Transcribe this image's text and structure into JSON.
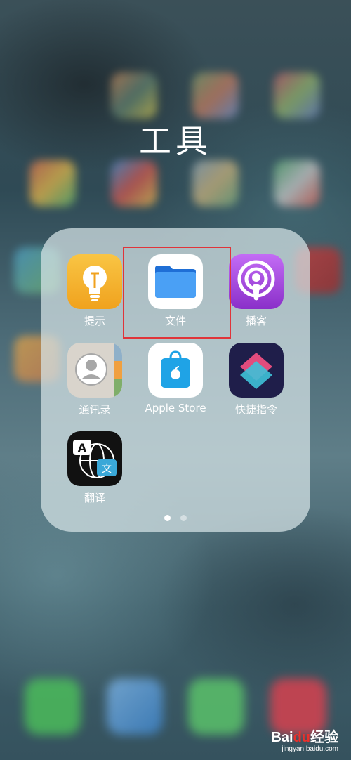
{
  "folder": {
    "title": "工具",
    "apps": [
      {
        "label": "提示",
        "icon": "tips-lightbulb-icon"
      },
      {
        "label": "文件",
        "icon": "files-folder-icon",
        "highlighted": true
      },
      {
        "label": "播客",
        "icon": "podcasts-icon"
      },
      {
        "label": "通讯录",
        "icon": "contacts-icon"
      },
      {
        "label": "Apple Store",
        "icon": "apple-store-bag-icon"
      },
      {
        "label": "快捷指令",
        "icon": "shortcuts-icon"
      },
      {
        "label": "翻译",
        "icon": "translate-icon"
      }
    ],
    "page_count": 2,
    "current_page": 1
  },
  "watermark": {
    "brand_left": "Bai",
    "brand_paw": "du",
    "brand_right": "经验",
    "url": "jingyan.baidu.com"
  },
  "colors": {
    "highlight_border": "#e0343a",
    "tips": "#f5b42a",
    "files": "#2f8bf0",
    "podcasts": "#9b3fd6",
    "apple_store": "#1fa3e6",
    "shortcuts_bg": "#1f1e4a",
    "translate_bg": "#111111"
  }
}
